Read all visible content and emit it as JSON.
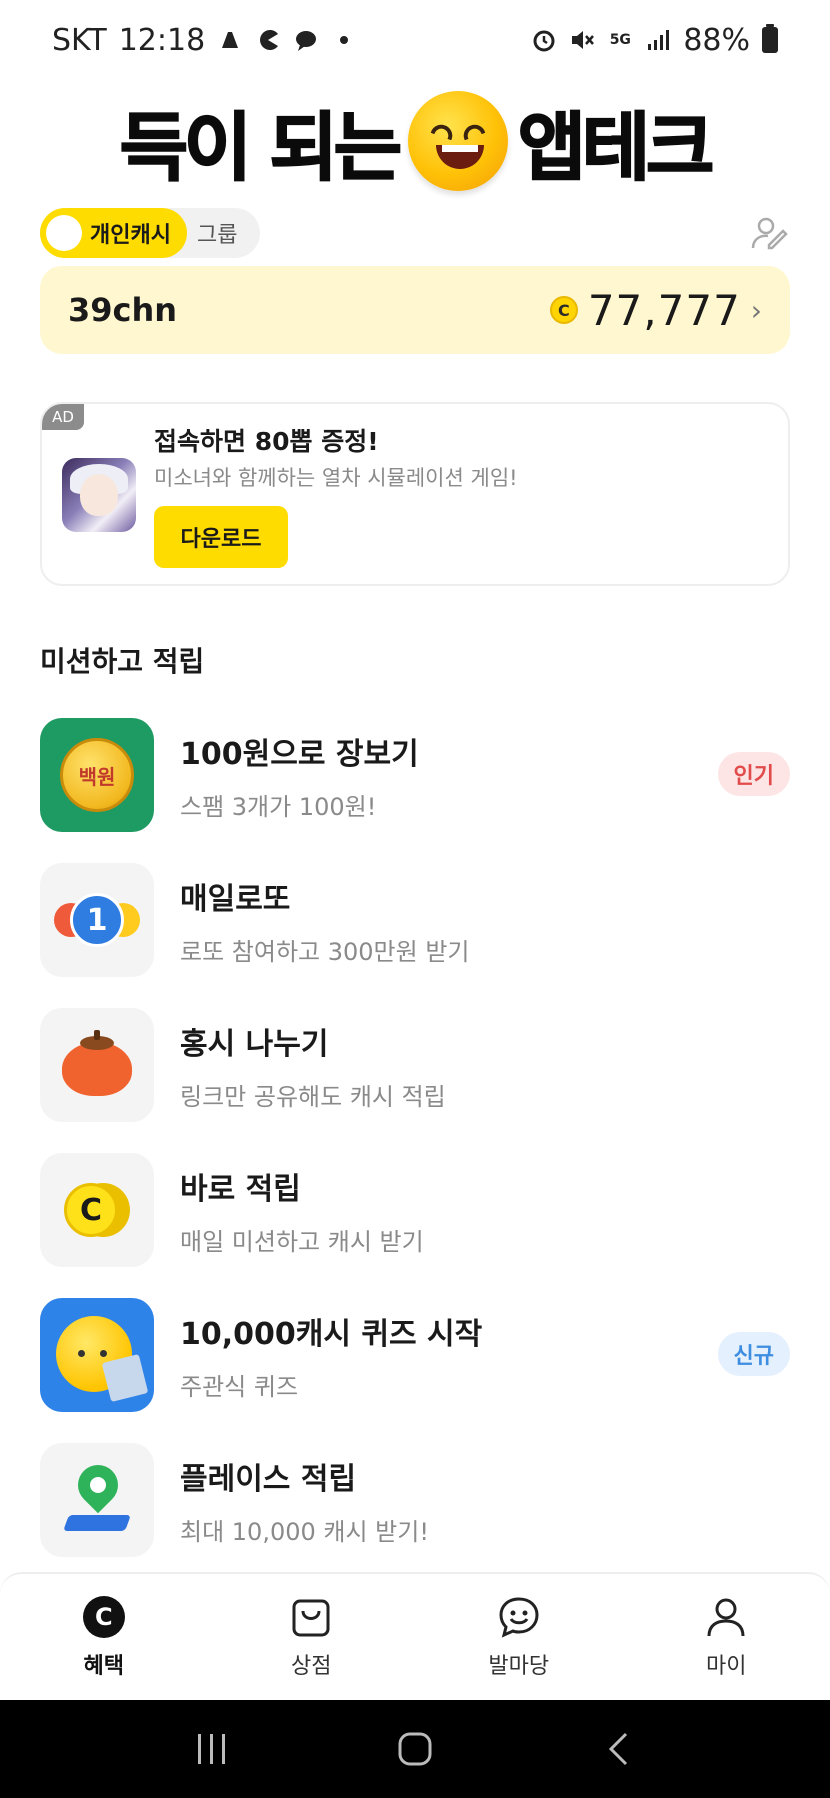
{
  "status_bar": {
    "carrier": "SKT",
    "time": "12:18",
    "battery": "88%",
    "network": "5G",
    "left_icons": [
      "app-icon",
      "pacman-icon",
      "chat-icon",
      "dot-icon"
    ],
    "right_icons": [
      "alarm-icon",
      "mute-icon",
      "5g-icon",
      "signal-icon",
      "battery-icon"
    ]
  },
  "hero": {
    "title_left": "득이 되는",
    "title_right": "앱테크"
  },
  "toggle": {
    "active": "개인캐시",
    "inactive": "그룹"
  },
  "balance": {
    "username": "39chn",
    "coin_symbol": "C",
    "amount": "77,777",
    "chevron": "›"
  },
  "ad": {
    "badge": "AD",
    "title": "접속하면 80뽑 증정!",
    "subtitle": "미소녀와 함께하는 열차 시뮬레이션 게임!",
    "button": "다운로드"
  },
  "missions_section": {
    "title": "미션하고 적립",
    "items": [
      {
        "title": "100원으로 장보기",
        "subtitle": "스팸 3개가 100원!",
        "badge": "인기",
        "icon": "coin-100-icon",
        "icon_text": "백원"
      },
      {
        "title": "매일로또",
        "subtitle": "로또 참여하고 300만원 받기",
        "badge": "",
        "icon": "lotto-balls-icon",
        "icon_text": "1"
      },
      {
        "title": "홍시 나누기",
        "subtitle": "링크만 공유해도 캐시 적립",
        "badge": "",
        "icon": "persimmon-icon",
        "icon_text": ""
      },
      {
        "title": "바로 적립",
        "subtitle": "매일 미션하고 캐시 받기",
        "badge": "",
        "icon": "cash-coin-icon",
        "icon_text": "C"
      },
      {
        "title": "10,000캐시 퀴즈 시작",
        "subtitle": "주관식 퀴즈",
        "badge": "신규",
        "icon": "quiz-face-icon",
        "icon_text": ""
      },
      {
        "title": "플레이스 적립",
        "subtitle": "최대 10,000 캐시 받기!",
        "badge": "",
        "icon": "map-pin-icon",
        "icon_text": ""
      }
    ]
  },
  "bottom_nav": {
    "items": [
      {
        "label": "혜택",
        "icon": "cash-c-icon",
        "active": true
      },
      {
        "label": "상점",
        "icon": "shopping-bag-icon",
        "active": false
      },
      {
        "label": "발마당",
        "icon": "chat-smile-icon",
        "active": false
      },
      {
        "label": "마이",
        "icon": "person-icon",
        "active": false
      }
    ]
  },
  "system_nav": {
    "items": [
      "recent-apps-icon",
      "home-icon",
      "back-icon"
    ]
  },
  "colors": {
    "accent_yellow": "#ffdc00",
    "balance_bg": "#fff7cf",
    "hot_badge": "#e24b4b",
    "new_badge": "#3d8de0"
  }
}
